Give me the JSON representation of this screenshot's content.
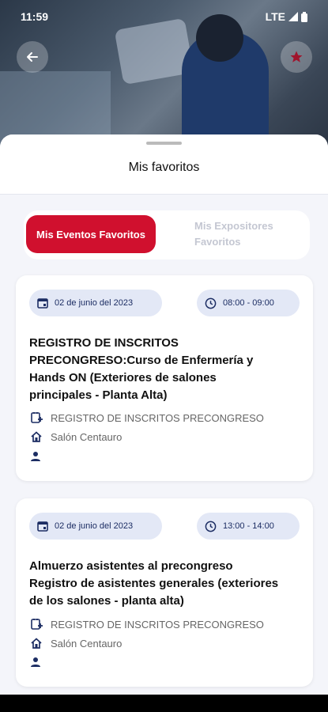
{
  "status_bar": {
    "time": "11:59",
    "network": "LTE"
  },
  "sheet": {
    "title": "Mis favoritos"
  },
  "tabs": {
    "active": "Mis Eventos Favoritos",
    "inactive": "Mis Expositores Favoritos"
  },
  "events": [
    {
      "date": "02 de junio del 2023",
      "time": "08:00 - 09:00",
      "title": "REGISTRO DE INSCRITOS PRECONGRESO:Curso de Enfermería y Hands ON (Exteriores de salones principales - Planta Alta)",
      "category": "REGISTRO DE INSCRITOS PRECONGRESO",
      "location": "Salón Centauro"
    },
    {
      "date": "02 de junio del 2023",
      "time": "13:00 - 14:00",
      "title": "Almuerzo asistentes al precongreso Registro de asistentes generales (exteriores de los salones - planta alta)",
      "category": "REGISTRO DE INSCRITOS PRECONGRESO",
      "location": "Salón Centauro"
    }
  ],
  "colors": {
    "accent": "#d0102e",
    "pill_bg": "#e3e8f6",
    "pill_text": "#1c2d63"
  }
}
